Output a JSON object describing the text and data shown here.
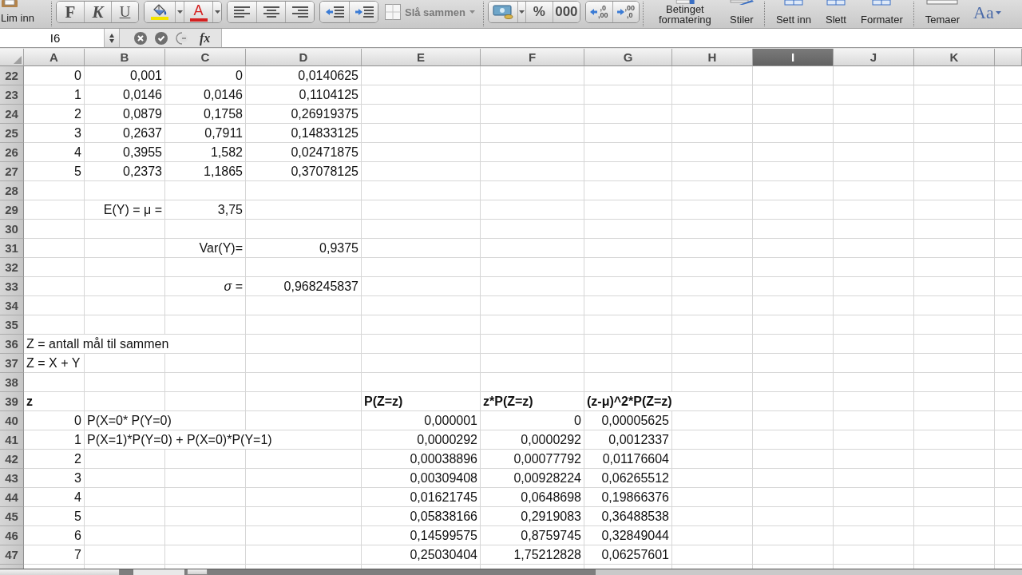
{
  "ribbon": {
    "paste": {
      "label": "Lim inn"
    },
    "font_style_buttons": [
      {
        "kind": "bold",
        "label": "F"
      },
      {
        "kind": "italic",
        "label": "K"
      },
      {
        "kind": "underline",
        "label": "U"
      }
    ],
    "color_buttons": [
      {
        "kind": "fill",
        "color": "#f2e400"
      },
      {
        "kind": "font",
        "label": "A",
        "color": "#d42020"
      }
    ],
    "merge": {
      "label": "Slå sammen"
    },
    "number_buttons": [
      {
        "label": "%"
      },
      {
        "label": "000"
      }
    ],
    "decimal_buttons": [
      {
        "kind": "increase",
        "top": ",0",
        "bottom": ",00"
      },
      {
        "kind": "decrease",
        "top": ",00",
        "bottom": ",0"
      }
    ],
    "command_groups": [
      {
        "items": [
          {
            "kind": "command",
            "label": "Betinget formatering"
          },
          {
            "kind": "command",
            "label": "Stiler"
          }
        ]
      },
      {
        "items": [
          {
            "kind": "command",
            "label": "Sett inn"
          },
          {
            "kind": "command",
            "label": "Slett"
          },
          {
            "kind": "command",
            "label": "Formater"
          }
        ]
      },
      {
        "items": [
          {
            "kind": "command",
            "label": "Temaer"
          },
          {
            "kind": "font_menu",
            "label": "Aa"
          }
        ]
      }
    ]
  },
  "formula_bar": {
    "name_box": "I6",
    "function_label": "fx"
  },
  "columns": [
    {
      "label": "A",
      "selected": false
    },
    {
      "label": "B",
      "selected": false
    },
    {
      "label": "C",
      "selected": false
    },
    {
      "label": "D",
      "selected": false
    },
    {
      "label": "E",
      "selected": false
    },
    {
      "label": "F",
      "selected": false
    },
    {
      "label": "G",
      "selected": false
    },
    {
      "label": "H",
      "selected": false
    },
    {
      "label": "I",
      "selected": true
    },
    {
      "label": "J",
      "selected": false
    },
    {
      "label": "K",
      "selected": false
    }
  ],
  "rows": [
    {
      "number": "22",
      "cells": {
        "A": {
          "kind": "number",
          "text": "0"
        },
        "B": {
          "kind": "number",
          "text": "0,001"
        },
        "C": {
          "kind": "number",
          "text": "0"
        },
        "D": {
          "kind": "number",
          "text": "0,0140625"
        }
      }
    },
    {
      "number": "23",
      "cells": {
        "A": {
          "kind": "number",
          "text": "1"
        },
        "B": {
          "kind": "number",
          "text": "0,0146"
        },
        "C": {
          "kind": "number",
          "text": "0,0146"
        },
        "D": {
          "kind": "number",
          "text": "0,1104125"
        }
      }
    },
    {
      "number": "24",
      "cells": {
        "A": {
          "kind": "number",
          "text": "2"
        },
        "B": {
          "kind": "number",
          "text": "0,0879"
        },
        "C": {
          "kind": "number",
          "text": "0,1758"
        },
        "D": {
          "kind": "number",
          "text": "0,26919375"
        }
      }
    },
    {
      "number": "25",
      "cells": {
        "A": {
          "kind": "number",
          "text": "3"
        },
        "B": {
          "kind": "number",
          "text": "0,2637"
        },
        "C": {
          "kind": "number",
          "text": "0,7911"
        },
        "D": {
          "kind": "number",
          "text": "0,14833125"
        }
      }
    },
    {
      "number": "26",
      "cells": {
        "A": {
          "kind": "number",
          "text": "4"
        },
        "B": {
          "kind": "number",
          "text": "0,3955"
        },
        "C": {
          "kind": "number",
          "text": "1,582"
        },
        "D": {
          "kind": "number",
          "text": "0,02471875"
        }
      }
    },
    {
      "number": "27",
      "cells": {
        "A": {
          "kind": "number",
          "text": "5"
        },
        "B": {
          "kind": "number",
          "text": "0,2373"
        },
        "C": {
          "kind": "number",
          "text": "1,1865"
        },
        "D": {
          "kind": "number",
          "text": "0,37078125"
        }
      }
    },
    {
      "number": "28",
      "cells": {}
    },
    {
      "number": "29",
      "cells": {
        "B": {
          "kind": "text_right",
          "text": "E(Y) = μ ="
        },
        "C": {
          "kind": "number",
          "text": "3,75"
        }
      }
    },
    {
      "number": "30",
      "cells": {}
    },
    {
      "number": "31",
      "cells": {
        "C": {
          "kind": "text_right",
          "text": "Var(Y)="
        },
        "D": {
          "kind": "number",
          "text": "0,9375"
        }
      }
    },
    {
      "number": "32",
      "cells": {}
    },
    {
      "number": "33",
      "cells": {
        "C": {
          "kind": "text_right",
          "text": "*σ* ="
        },
        "D": {
          "kind": "number",
          "text": "0,968245837"
        }
      }
    },
    {
      "number": "34",
      "cells": {}
    },
    {
      "number": "35",
      "cells": {}
    },
    {
      "number": "36",
      "cells": {
        "A": {
          "kind": "text",
          "text": "Z = antall mål til sammen"
        }
      }
    },
    {
      "number": "37",
      "cells": {
        "A": {
          "kind": "text",
          "text": "Z = X + Y"
        }
      }
    },
    {
      "number": "38",
      "cells": {}
    },
    {
      "number": "39",
      "cells": {
        "A": {
          "kind": "header",
          "text": "z"
        },
        "E": {
          "kind": "header",
          "text": "P(Z=z)"
        },
        "F": {
          "kind": "header",
          "text": "z*P(Z=z)"
        },
        "G": {
          "kind": "header",
          "text": "(z-μ)^2*P(Z=z)"
        }
      }
    },
    {
      "number": "40",
      "cells": {
        "A": {
          "kind": "number",
          "text": "0"
        },
        "B": {
          "kind": "text",
          "text": "P(X=0* P(Y=0)"
        },
        "E": {
          "kind": "number",
          "text": "0,000001"
        },
        "F": {
          "kind": "number",
          "text": "0"
        },
        "G": {
          "kind": "number",
          "text": "0,00005625"
        }
      }
    },
    {
      "number": "41",
      "cells": {
        "A": {
          "kind": "number",
          "text": "1"
        },
        "B": {
          "kind": "text",
          "text": "P(X=1)*P(Y=0) + P(X=0)*P(Y=1)"
        },
        "E": {
          "kind": "number",
          "text": "0,0000292"
        },
        "F": {
          "kind": "number",
          "text": "0,0000292"
        },
        "G": {
          "kind": "number",
          "text": "0,0012337"
        }
      }
    },
    {
      "number": "42",
      "cells": {
        "A": {
          "kind": "number",
          "text": "2"
        },
        "E": {
          "kind": "number",
          "text": "0,00038896"
        },
        "F": {
          "kind": "number",
          "text": "0,00077792"
        },
        "G": {
          "kind": "number",
          "text": "0,01176604"
        }
      }
    },
    {
      "number": "43",
      "cells": {
        "A": {
          "kind": "number",
          "text": "3"
        },
        "E": {
          "kind": "number",
          "text": "0,00309408"
        },
        "F": {
          "kind": "number",
          "text": "0,00928224"
        },
        "G": {
          "kind": "number",
          "text": "0,06265512"
        }
      }
    },
    {
      "number": "44",
      "cells": {
        "A": {
          "kind": "number",
          "text": "4"
        },
        "E": {
          "kind": "number",
          "text": "0,01621745"
        },
        "F": {
          "kind": "number",
          "text": "0,0648698"
        },
        "G": {
          "kind": "number",
          "text": "0,19866376"
        }
      }
    },
    {
      "number": "45",
      "cells": {
        "A": {
          "kind": "number",
          "text": "5"
        },
        "E": {
          "kind": "number",
          "text": "0,05838166"
        },
        "F": {
          "kind": "number",
          "text": "0,2919083"
        },
        "G": {
          "kind": "number",
          "text": "0,36488538"
        }
      }
    },
    {
      "number": "46",
      "cells": {
        "A": {
          "kind": "number",
          "text": "6"
        },
        "E": {
          "kind": "number",
          "text": "0,14599575"
        },
        "F": {
          "kind": "number",
          "text": "0,8759745"
        },
        "G": {
          "kind": "number",
          "text": "0,32849044"
        }
      }
    },
    {
      "number": "47",
      "cells": {
        "A": {
          "kind": "number",
          "text": "7"
        },
        "E": {
          "kind": "number",
          "text": "0,25030404"
        },
        "F": {
          "kind": "number",
          "text": "1,75212828"
        },
        "G": {
          "kind": "number",
          "text": "0,06257601"
        }
      }
    }
  ]
}
